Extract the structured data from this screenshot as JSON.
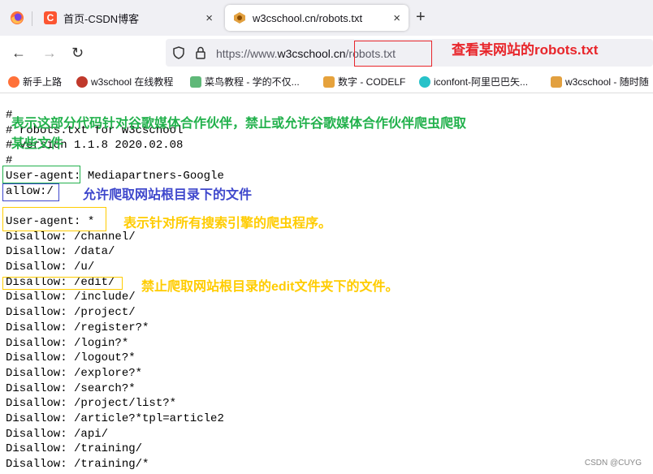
{
  "tabs": [
    {
      "label": "首页-CSDN博客",
      "active": false
    },
    {
      "label": "w3cschool.cn/robots.txt",
      "active": true
    }
  ],
  "tab_close": "×",
  "new_tab": "+",
  "nav": {
    "back": "←",
    "forward": "→",
    "reload": "↻"
  },
  "url": {
    "scheme": "https://www.",
    "host": "w3cschool.cn",
    "path": "/robots.txt"
  },
  "bookmarks": [
    "新手上路",
    "w3school 在线教程",
    "菜鸟教程 - 学的不仅...",
    "数字 - CODELF",
    "iconfont-阿里巴巴矢...",
    "w3cschool - 随时随"
  ],
  "code_lines": [
    "#",
    "# robots.txt for w3cschool",
    "# version 1.1.8 2020.02.08",
    "#",
    "User-agent: Mediapartners-Google",
    "allow:/",
    "",
    "User-agent: *",
    "Disallow: /channel/",
    "Disallow: /data/",
    "Disallow: /u/",
    "Disallow: /edit/",
    "Disallow: /include/",
    "Disallow: /project/",
    "Disallow: /register?*",
    "Disallow: /login?*",
    "Disallow: /logout?*",
    "Disallow: /explore?*",
    "Disallow: /search?*",
    "Disallow: /project/list?*",
    "Disallow: /article?*tpl=article2",
    "Disallow: /api/",
    "Disallow: /training/",
    "Disallow: /training/*"
  ],
  "annotations": {
    "robots": "查看某网站的robots.txt",
    "google_line1": "表示这部分代码针对谷歌媒体合作伙伴，禁止或允许谷歌媒体合作伙伴爬虫爬取",
    "google_line2": "某些文件",
    "allow": "允许爬取网站根目录下的文件",
    "all_agents": "表示针对所有搜索引擎的爬虫程序。",
    "edit": "禁止爬取网站根目录的edit文件夹下的文件。"
  },
  "watermark": "CSDN @CUYG",
  "colors": {
    "red": "#e8262b",
    "green": "#22b14c",
    "blue": "#3f48cc",
    "yellow": "#ffcc00"
  }
}
